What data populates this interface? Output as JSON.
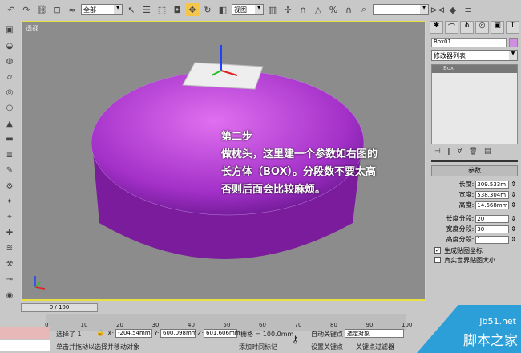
{
  "toolbar": {
    "filter_select": "全部",
    "ref_coord_select": "视图",
    "named_selection": ""
  },
  "viewport": {
    "label": "透视",
    "overlay_lines": [
      "第二步",
      "做枕头，这里建一个参数如右图的",
      "长方体（BOX）。分段数不要太高",
      "否则后面会比较麻烦。"
    ]
  },
  "panel": {
    "object_name": "Box01",
    "object_color": "#d090e0",
    "modifier_list": "修改器列表",
    "stack_item": "Box",
    "rollout_title": "参数",
    "params": [
      {
        "label": "长度:",
        "value": "309.533m"
      },
      {
        "label": "宽度:",
        "value": "538.304m"
      },
      {
        "label": "高度:",
        "value": "14.668mm"
      }
    ],
    "segs": [
      {
        "label": "长度分段:",
        "value": "20"
      },
      {
        "label": "宽度分段:",
        "value": "30"
      },
      {
        "label": "高度分段:",
        "value": "1"
      }
    ],
    "checks": [
      {
        "label": "生成贴图坐标",
        "checked": true
      },
      {
        "label": "真实世界贴图大小",
        "checked": false
      }
    ]
  },
  "timeline": {
    "slider": "0 / 100",
    "ticks": [
      "0",
      "10",
      "20",
      "30",
      "40",
      "50",
      "60",
      "70",
      "80",
      "90",
      "100"
    ]
  },
  "status": {
    "selected": "选择了 1",
    "x_label": "X:",
    "x": "-204.54mm",
    "y_label": "Y:",
    "y": "600.098mm",
    "z_label": "Z:",
    "z": "601.606mm",
    "grid": "栅格 = 100.0mm",
    "auto_key": "自动关键点",
    "set_key": "设置关键点",
    "key_mode": "选定对象",
    "key_filters": "关键点过滤器",
    "add_time_tag": "添加时间标记",
    "prompt": "单击并拖动以选择并移动对象"
  },
  "watermark": {
    "site": "jb51.net",
    "name": "脚本之家"
  }
}
